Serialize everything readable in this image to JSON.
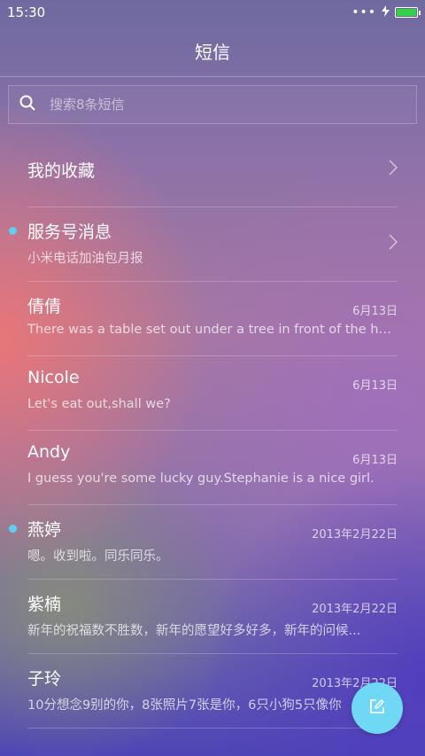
{
  "status_bar": {
    "time": "15:30",
    "dots": "•••",
    "charging_icon": "lightning-icon",
    "battery_level": 1.0,
    "battery_color": "#33d14a"
  },
  "header": {
    "title": "短信"
  },
  "search": {
    "placeholder": "搜索8条短信",
    "value": ""
  },
  "list": {
    "items": [
      {
        "name": "我的收藏",
        "preview": "",
        "date": "",
        "unread": false,
        "chevron": true
      },
      {
        "name": "服务号消息",
        "preview": "小米电话加油包月报",
        "date": "",
        "unread": true,
        "chevron": true
      },
      {
        "name": "倩倩",
        "preview": "There was a table set out under a tree in front of the ho...",
        "date": "6月13日",
        "unread": false,
        "chevron": false
      },
      {
        "name": "Nicole",
        "preview": "Let's eat out,shall we?",
        "date": "6月13日",
        "unread": false,
        "chevron": false
      },
      {
        "name": "Andy",
        "preview": "I guess you're some lucky guy.Stephanie is a nice girl.",
        "date": "6月13日",
        "unread": false,
        "chevron": false
      },
      {
        "name": "燕婷",
        "preview": "嗯。收到啦。同乐同乐。",
        "date": "2013年2月22日",
        "unread": true,
        "chevron": false
      },
      {
        "name": "紫楠",
        "preview": "新年的祝福数不胜数，新年的愿望好多好多，新年的问候...",
        "date": "2013年2月22日",
        "unread": false,
        "chevron": false
      },
      {
        "name": "子玲",
        "preview": "10分想念9别的你，8张照片7张是你，6只小狗5只像你",
        "date": "2013年2月22日",
        "unread": false,
        "chevron": false
      }
    ]
  },
  "fab": {
    "icon": "compose-icon",
    "color": "#6fd8f5"
  },
  "colors": {
    "unread_dot": "#5ccff3"
  }
}
